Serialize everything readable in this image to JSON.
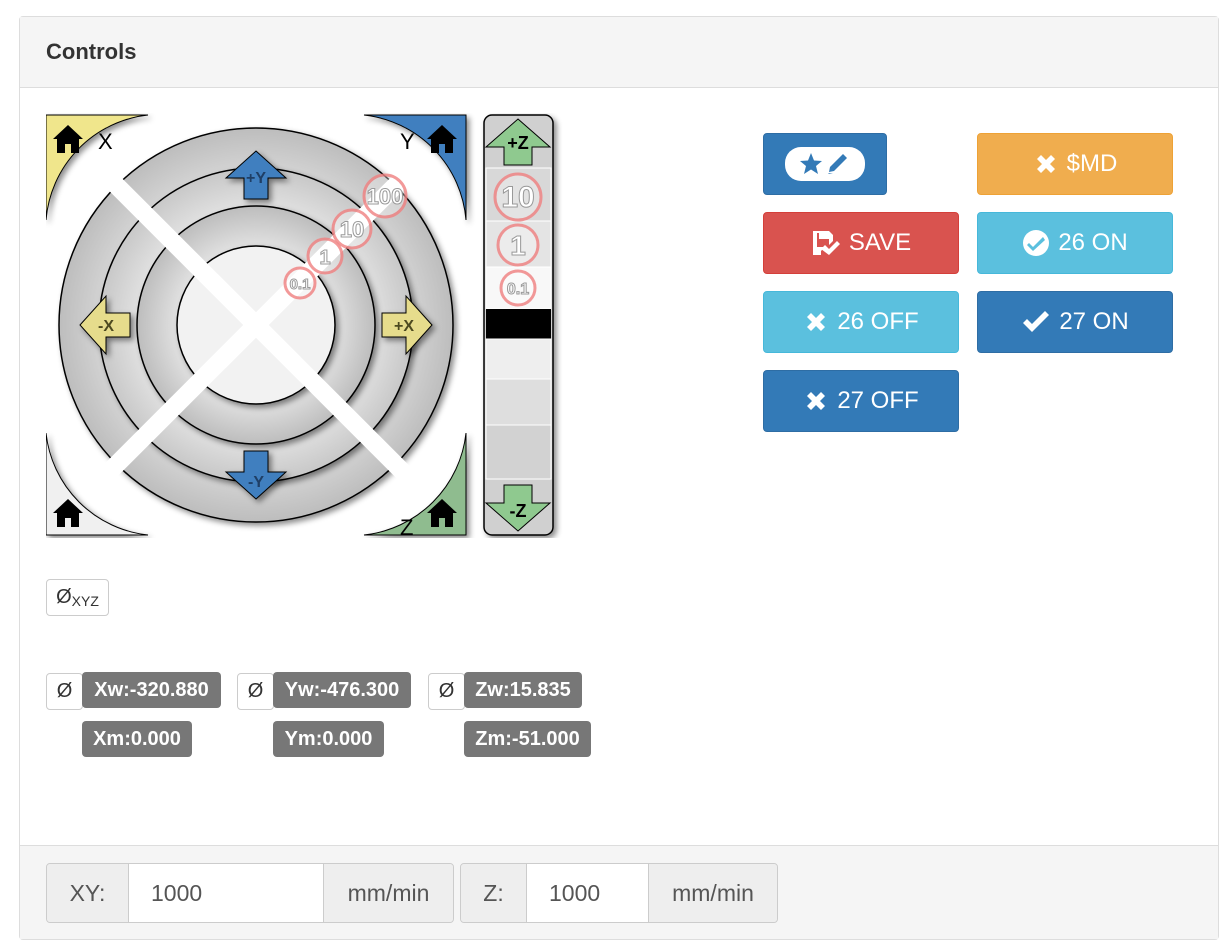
{
  "panel": {
    "title": "Controls"
  },
  "jog": {
    "home_x_label": "X",
    "home_y_label": "Y",
    "home_z_label": "Z",
    "y_plus": "+Y",
    "y_minus": "-Y",
    "x_plus": "+X",
    "x_minus": "-X",
    "z_plus": "+Z",
    "z_minus": "-Z",
    "z_steps": [
      "10",
      "1",
      "0.1"
    ],
    "xy_steps": [
      "100",
      "10",
      "1",
      "0.1"
    ],
    "zero_all_symbol": "Ø",
    "zero_all_sub": "XYZ"
  },
  "buttons": {
    "md_label": "$MD",
    "save_label": "SAVE",
    "on26_label": "26 ON",
    "off26_label": "26 OFF",
    "on27_label": "27 ON",
    "off27_label": "27 OFF"
  },
  "positions": {
    "zero_symbol": "Ø",
    "xw": "Xw:-320.880",
    "xm": "Xm:0.000",
    "yw": "Yw:-476.300",
    "ym": "Ym:0.000",
    "zw": "Zw:15.835",
    "zm": "Zm:-51.000"
  },
  "feedrate": {
    "xy_label": "XY:",
    "xy_value": "1000",
    "xy_unit": "mm/min",
    "z_label": "Z:",
    "z_value": "1000",
    "z_unit": "mm/min"
  },
  "colors": {
    "primary": "#337ab7",
    "warning": "#f0ad4e",
    "danger": "#d9534f",
    "info": "#5bc0de",
    "label": "#777777",
    "home_x": "#f0e68c",
    "home_y": "#337ab7",
    "home_z": "#8fbc8f"
  },
  "icons": {
    "home": "home-icon",
    "bookmark": "star-pencil-icon",
    "close": "close-icon",
    "save": "save-icon",
    "check_circle": "check-circle-icon",
    "check": "check-icon"
  }
}
